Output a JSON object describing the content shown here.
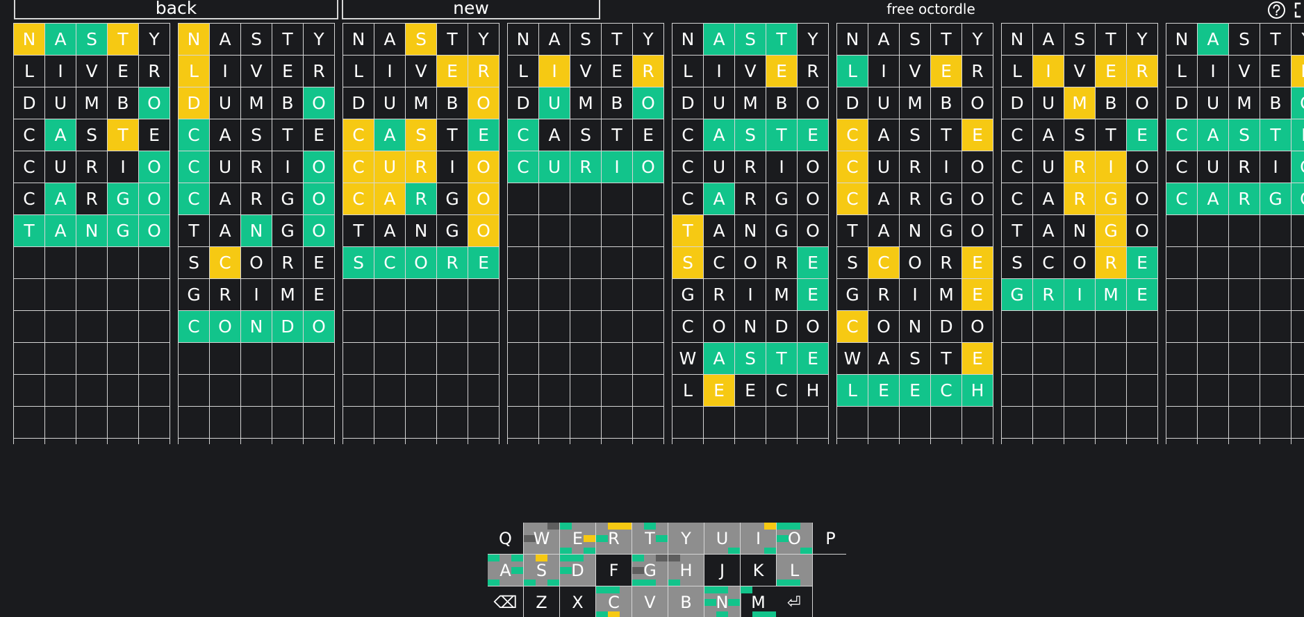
{
  "header": {
    "back_label": "back",
    "new_label": "new",
    "title": "free octordle"
  },
  "colors": {
    "background": "#1a1b1e",
    "green": "#12c48b",
    "yellow": "#f6c913",
    "key_gray": "#8e8e8e"
  },
  "icons": [
    "help-icon",
    "fullscreen-icon",
    "backspace-icon",
    "enter-icon"
  ],
  "guesses": [
    "NASTY",
    "LIVER",
    "DUMBO",
    "CASTE",
    "CURIO",
    "CARGO",
    "TANGO",
    "SCORE",
    "GRIME",
    "CONDO",
    "WASTE",
    "LEECH",
    "",
    ""
  ],
  "boards": [
    {
      "rows": 7,
      "colors": [
        "yggyb",
        "bbbbb",
        "bbbbg",
        "bgbyb",
        "bbbbg",
        "bgbgg",
        "ggggg"
      ]
    },
    {
      "rows": 10,
      "colors": [
        "ybbbb",
        "ybbbb",
        "ybbbg",
        "gbbbb",
        "gbbbg",
        "gbbbg",
        "bbgbg",
        "bybbb",
        "bbbbb",
        "ggggg"
      ]
    },
    {
      "rows": 8,
      "colors": [
        "bbybb",
        "bbbyy",
        "bbbby",
        "ygybg",
        "yyyby",
        "yygby",
        "bbbby",
        "ggggg"
      ]
    },
    {
      "rows": 5,
      "colors": [
        "bbbbb",
        "bybby",
        "bgbbg",
        "gbbbb",
        "ggggg"
      ]
    },
    {
      "rows": 12,
      "colors": [
        "bgggb",
        "bbbyb",
        "bbbbb",
        "bgggg",
        "bbbbb",
        "bgbbb",
        "ybbbb",
        "ybbbg",
        "bbbbg",
        "bbbbb",
        "bgggg",
        "bybbb"
      ]
    },
    {
      "rows": 12,
      "colors": [
        "bbbbb",
        "gbbyb",
        "bbbbb",
        "ybbby",
        "ybbbb",
        "ybbbb",
        "bbbbb",
        "bybby",
        "bbbby",
        "ybbbb",
        "bbbby",
        "ggggg"
      ]
    },
    {
      "rows": 9,
      "colors": [
        "bbbbb",
        "bybyy",
        "bbybb",
        "bbbbg",
        "bbyyb",
        "bbyyb",
        "bbbyb",
        "bbbyg",
        "ggggg"
      ]
    },
    {
      "rows": 6,
      "colors": [
        "bgbbb",
        "bbbby",
        "bbbbg",
        "ggggg",
        "bbbbg",
        "ggggg"
      ]
    }
  ],
  "keyboard": {
    "rows": [
      [
        {
          "k": "Q",
          "gray": false,
          "m": []
        },
        {
          "k": "W",
          "gray": true,
          "m": [
            [
              2,
              "d"
            ],
            [
              3,
              "d"
            ]
          ]
        },
        {
          "k": "E",
          "gray": true,
          "m": [
            [
              0,
              "g"
            ],
            [
              4,
              "y"
            ],
            [
              5,
              "g"
            ],
            [
              7,
              "g"
            ]
          ]
        },
        {
          "k": "R",
          "gray": true,
          "m": [
            [
              1,
              "y"
            ],
            [
              2,
              "y"
            ],
            [
              3,
              "g"
            ]
          ]
        },
        {
          "k": "T",
          "gray": true,
          "m": [
            [
              1,
              "g"
            ],
            [
              4,
              "g"
            ]
          ]
        },
        {
          "k": "Y",
          "gray": true,
          "m": []
        },
        {
          "k": "U",
          "gray": true,
          "m": [
            [
              7,
              "g"
            ]
          ]
        },
        {
          "k": "I",
          "gray": true,
          "m": [
            [
              2,
              "y"
            ],
            [
              7,
              "g"
            ]
          ]
        },
        {
          "k": "O",
          "gray": true,
          "m": [
            [
              0,
              "g"
            ],
            [
              1,
              "g"
            ],
            [
              3,
              "g"
            ],
            [
              7,
              "g"
            ]
          ]
        },
        {
          "k": "P",
          "gray": false,
          "m": []
        }
      ],
      [
        {
          "k": "A",
          "gray": true,
          "m": [
            [
              0,
              "g"
            ],
            [
              2,
              "g"
            ],
            [
              4,
              "g"
            ],
            [
              5,
              "g"
            ]
          ]
        },
        {
          "k": "S",
          "gray": true,
          "m": [
            [
              1,
              "y"
            ],
            [
              5,
              "g"
            ],
            [
              7,
              "g"
            ]
          ]
        },
        {
          "k": "D",
          "gray": true,
          "m": [
            [
              0,
              "g"
            ],
            [
              1,
              "g"
            ],
            [
              3,
              "g"
            ]
          ]
        },
        {
          "k": "F",
          "gray": false,
          "m": []
        },
        {
          "k": "G",
          "gray": true,
          "m": [
            [
              0,
              "g"
            ],
            [
              2,
              "d"
            ],
            [
              3,
              "d"
            ],
            [
              5,
              "g"
            ],
            [
              6,
              "g"
            ]
          ]
        },
        {
          "k": "H",
          "gray": true,
          "m": [
            [
              0,
              "d"
            ],
            [
              5,
              "g"
            ]
          ]
        },
        {
          "k": "J",
          "gray": false,
          "m": []
        },
        {
          "k": "K",
          "gray": false,
          "m": []
        },
        {
          "k": "L",
          "gray": true,
          "m": [
            [
              5,
              "g"
            ],
            [
              6,
              "g"
            ]
          ]
        }
      ],
      [
        {
          "k": "BACKSPACE",
          "gray": false,
          "m": []
        },
        {
          "k": "Z",
          "gray": false,
          "m": []
        },
        {
          "k": "X",
          "gray": false,
          "m": []
        },
        {
          "k": "C",
          "gray": true,
          "m": [
            [
              0,
              "g"
            ],
            [
              1,
              "g"
            ],
            [
              5,
              "g"
            ],
            [
              6,
              "y"
            ]
          ]
        },
        {
          "k": "V",
          "gray": true,
          "m": []
        },
        {
          "k": "B",
          "gray": true,
          "m": []
        },
        {
          "k": "N",
          "gray": true,
          "m": [
            [
              0,
              "g"
            ],
            [
              1,
              "g"
            ],
            [
              3,
              "g"
            ],
            [
              4,
              "g"
            ],
            [
              6,
              "g"
            ]
          ]
        },
        {
          "k": "M",
          "gray": true,
          "m": [
            [
              0,
              "g"
            ],
            [
              6,
              "g"
            ],
            [
              7,
              "g"
            ]
          ]
        },
        {
          "k": "ENTER",
          "gray": false,
          "m": []
        }
      ]
    ]
  }
}
